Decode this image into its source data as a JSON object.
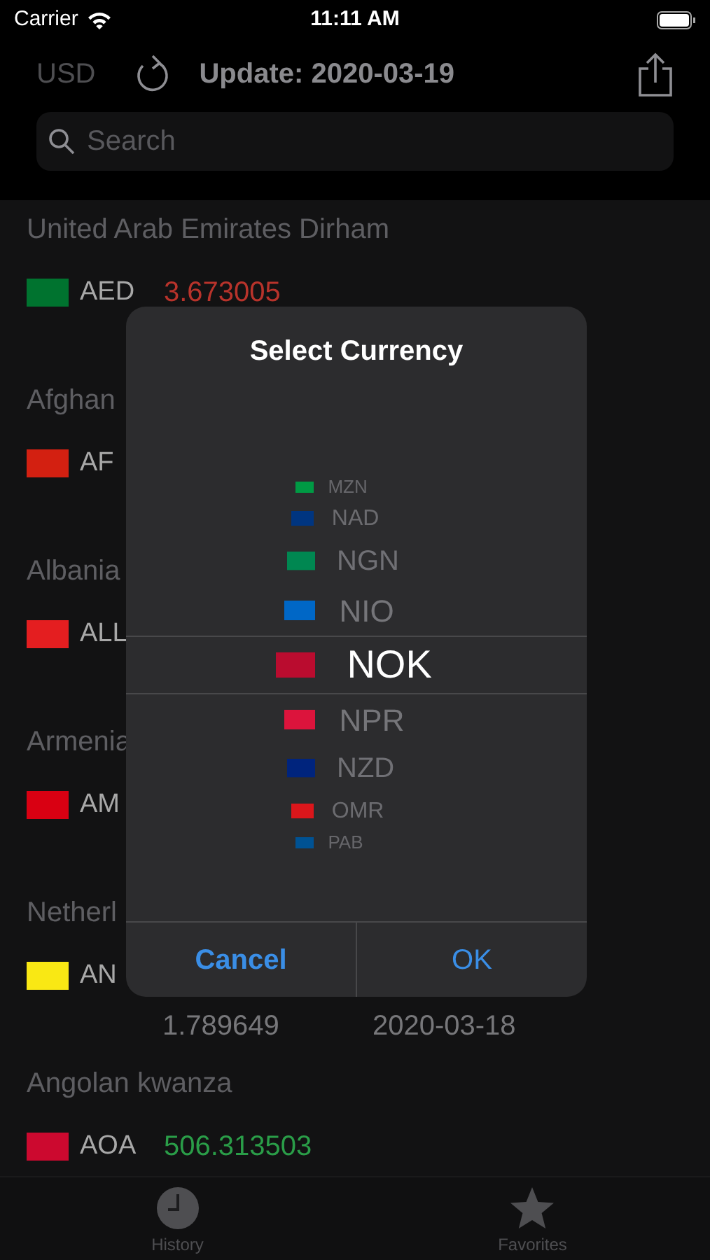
{
  "status_bar": {
    "carrier": "Carrier",
    "time": "11:11 AM"
  },
  "nav": {
    "base_currency": "USD",
    "title": "Update: 2020-03-19"
  },
  "search": {
    "placeholder": "Search"
  },
  "rows": [
    {
      "name": "United Arab Emirates Dirham",
      "code": "AED",
      "rate": {
        "text": "3.673005",
        "color": "#b8332b"
      },
      "color": "#00732f"
    },
    {
      "name": "Afghan",
      "code": "AF",
      "color": "#d32011"
    },
    {
      "name": "Albania",
      "code": "ALL",
      "color": "#e41e20"
    },
    {
      "name": "Armenia",
      "code": "AM",
      "color": "#d90012"
    },
    {
      "name": "Netherl",
      "code": "AN",
      "color": "#f9e814",
      "history_rate": "1.789649",
      "history_date": "2020-03-18"
    },
    {
      "name": "Angolan kwanza",
      "code": "AOA",
      "rate": {
        "text": "506.313503",
        "color": "#2a9d48"
      },
      "color": "#cc092f"
    }
  ],
  "dialog": {
    "title": "Select Currency",
    "options": [
      {
        "code": "MZN",
        "selected": false,
        "color": "#009a44"
      },
      {
        "code": "NAD",
        "selected": false,
        "color": "#003580"
      },
      {
        "code": "NGN",
        "selected": false,
        "color": "#008751"
      },
      {
        "code": "NIO",
        "selected": false,
        "color": "#0067c6"
      },
      {
        "code": "NOK",
        "selected": true,
        "color": "#ba0c2f"
      },
      {
        "code": "NPR",
        "selected": false,
        "color": "#dc143c"
      },
      {
        "code": "NZD",
        "selected": false,
        "color": "#00247d"
      },
      {
        "code": "OMR",
        "selected": false,
        "color": "#db161b"
      },
      {
        "code": "PAB",
        "selected": false,
        "color": "#005293"
      }
    ],
    "buttons": [
      "Cancel",
      "OK"
    ]
  },
  "tabs": [
    {
      "label": "History",
      "kind": "clock",
      "selected": false
    },
    {
      "label": "Favorites",
      "kind": "star",
      "selected": false
    }
  ]
}
